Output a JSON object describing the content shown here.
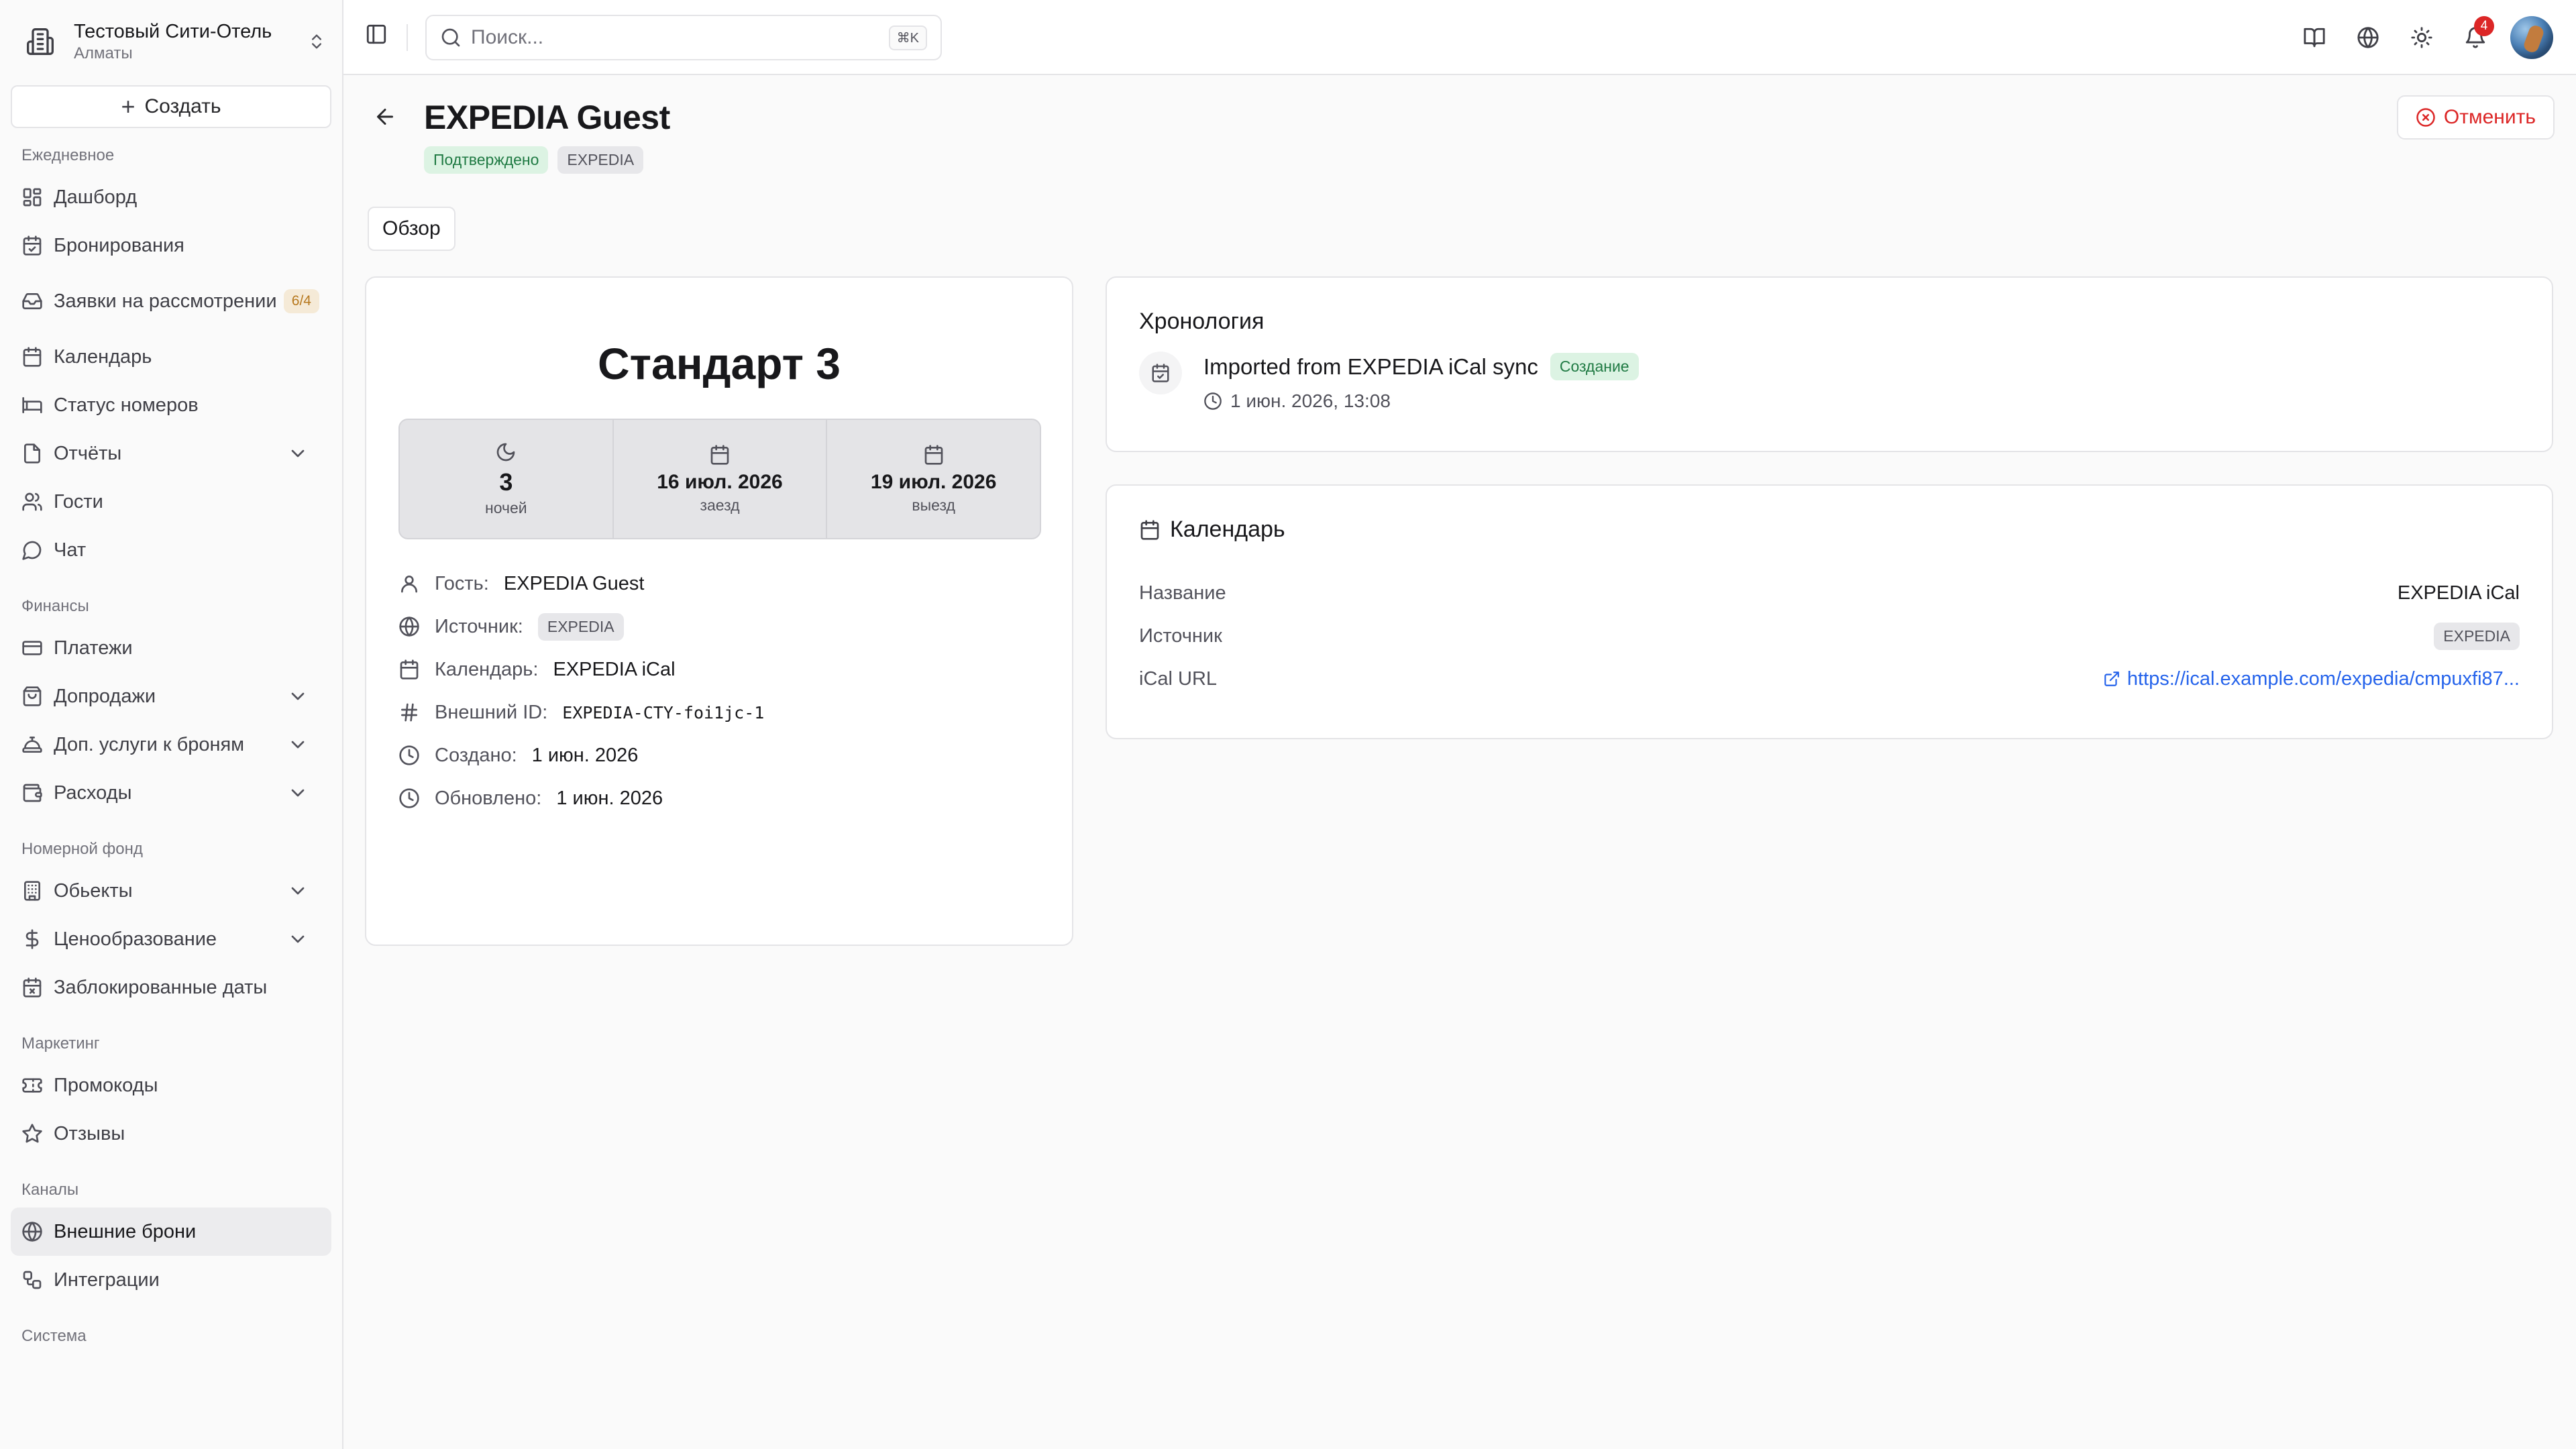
{
  "org": {
    "name": "Тестовый Сити-Отель",
    "city": "Алматы"
  },
  "sidebar": {
    "create_label": "Создать",
    "groups": [
      {
        "label": "Ежедневное",
        "items": [
          {
            "label": "Дашборд",
            "icon": "dashboard-icon"
          },
          {
            "label": "Бронирования",
            "icon": "calendar-check-icon"
          },
          {
            "label": "Заявки на рассмотрении",
            "icon": "inbox-icon",
            "badge": "6/4"
          },
          {
            "label": "Календарь",
            "icon": "calendar-icon"
          },
          {
            "label": "Статус номеров",
            "icon": "bed-icon"
          },
          {
            "label": "Отчёты",
            "icon": "file-icon",
            "expandable": true
          },
          {
            "label": "Гости",
            "icon": "users-icon"
          },
          {
            "label": "Чат",
            "icon": "chat-icon"
          }
        ]
      },
      {
        "label": "Финансы",
        "items": [
          {
            "label": "Платежи",
            "icon": "credit-card-icon"
          },
          {
            "label": "Допродажи",
            "icon": "shopping-bag-icon",
            "expandable": true
          },
          {
            "label": "Доп. услуги к броням",
            "icon": "concierge-bell-icon",
            "expandable": true
          },
          {
            "label": "Расходы",
            "icon": "wallet-icon",
            "expandable": true
          }
        ]
      },
      {
        "label": "Номерной фонд",
        "items": [
          {
            "label": "Обьекты",
            "icon": "building-icon",
            "expandable": true
          },
          {
            "label": "Ценообразование",
            "icon": "dollar-icon",
            "expandable": true
          },
          {
            "label": "Заблокированные даты",
            "icon": "calendar-x-icon"
          }
        ]
      },
      {
        "label": "Маркетинг",
        "items": [
          {
            "label": "Промокоды",
            "icon": "ticket-icon"
          },
          {
            "label": "Отзывы",
            "icon": "star-icon"
          }
        ]
      },
      {
        "label": "Каналы",
        "items": [
          {
            "label": "Внешние брони",
            "icon": "globe-icon",
            "active": true
          },
          {
            "label": "Интеграции",
            "icon": "workflow-icon"
          }
        ]
      },
      {
        "label": "Система",
        "items": []
      }
    ]
  },
  "topbar": {
    "search_placeholder": "Поиск...",
    "search_shortcut": "⌘K",
    "notifications_count": "4"
  },
  "page": {
    "title": "EXPEDIA Guest",
    "status": "Подтверждено",
    "source_tag": "EXPEDIA",
    "cancel_label": "Отменить",
    "tab": "Обзор"
  },
  "reservation": {
    "room": "Стандарт 3",
    "nights": "3",
    "nights_label": "ночей",
    "checkin": "16 июл. 2026",
    "checkin_label": "заезд",
    "checkout": "19 июл. 2026",
    "checkout_label": "выезд",
    "details": {
      "guest_label": "Гость:",
      "guest": "EXPEDIA Guest",
      "source_label": "Источник:",
      "source": "EXPEDIA",
      "calendar_label": "Календарь:",
      "calendar": "EXPEDIA iCal",
      "external_id_label": "Внешний ID:",
      "external_id": "EXPEDIA-CTY-foi1jc-1",
      "created_label": "Создано:",
      "created": "1 июн. 2026",
      "updated_label": "Обновлено:",
      "updated": "1 июн. 2026"
    }
  },
  "timeline": {
    "title": "Хронология",
    "event_title": "Imported from EXPEDIA iCal sync",
    "event_badge": "Создание",
    "event_time": "1 июн. 2026, 13:08"
  },
  "calendar_card": {
    "title": "Календарь",
    "name_label": "Название",
    "name": "EXPEDIA iCal",
    "source_label": "Источник",
    "source": "EXPEDIA",
    "url_label": "iCal URL",
    "url": "https://ical.example.com/expedia/cmpuxfi87..."
  }
}
